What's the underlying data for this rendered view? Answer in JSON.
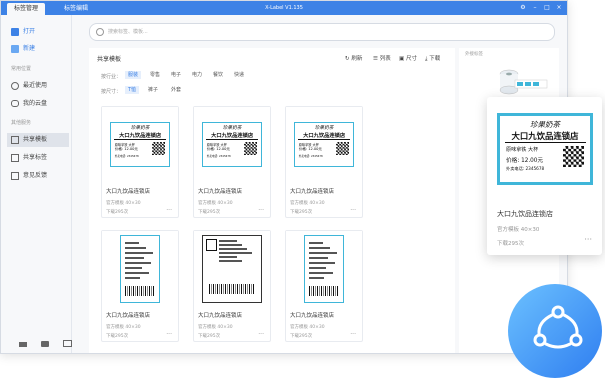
{
  "titlebar": {
    "tabs": [
      "标签管理",
      "标签编辑"
    ],
    "app_title": "X-Label  V1.135"
  },
  "sidebar": {
    "open": "打开",
    "new": "新建",
    "section_common": "常用位置",
    "recent": "最近使用",
    "my_cloud": "我的云盘",
    "section_other": "其他服务",
    "share_template": "共享模板",
    "share_label": "共享标签",
    "feedback": "意见反馈"
  },
  "search": {
    "placeholder": "搜索标签、模板..."
  },
  "panel": {
    "title": "共享模板",
    "tools": {
      "refresh": "刷新",
      "list": "列表",
      "size": "尺寸",
      "download": "下载"
    },
    "filter_industry": {
      "label": "按行业：",
      "options": [
        "服装",
        "零售",
        "电子",
        "电力",
        "餐饮",
        "快递"
      ],
      "selected": "服装"
    },
    "filter_size": {
      "label": "按尺寸：",
      "options": [
        "T恤",
        "裤子",
        "外套"
      ],
      "selected": "T恤"
    }
  },
  "label_sample": {
    "brand": "珍果奶茶",
    "shop": "大口九饮品连锁店",
    "line1": "原味拿铁  大杯",
    "line2": "价格: 12.00元",
    "line3": "外卖电话: 2345678"
  },
  "cards": [
    {
      "title": "大口九饮品连锁店",
      "sub": "官方模板  40×30",
      "downloads": "下载295次",
      "kind": "drink"
    },
    {
      "title": "大口九饮品连锁店",
      "sub": "官方模板  40×30",
      "downloads": "下载295次",
      "kind": "drink"
    },
    {
      "title": "大口九饮品连锁店",
      "sub": "官方模板  40×30",
      "downloads": "下载295次",
      "kind": "drink"
    },
    {
      "title": "大口九饮品连锁店",
      "sub": "官方模板  40×30",
      "downloads": "下载295次",
      "kind": "tag"
    },
    {
      "title": "大口九饮品连锁店",
      "sub": "官方模板  40×30",
      "downloads": "下载295次",
      "kind": "ship"
    },
    {
      "title": "大口九饮品连锁店",
      "sub": "官方模板  40×30",
      "downloads": "下载295次",
      "kind": "tag"
    }
  ],
  "right_panel": {
    "label": "外接标签"
  },
  "popup": {
    "title": "大口九饮品连锁店",
    "sub": "官方模板  40×30",
    "downloads": "下载295次"
  },
  "colors": {
    "accent": "#3d82e6",
    "label_border": "#3fb6d9"
  }
}
